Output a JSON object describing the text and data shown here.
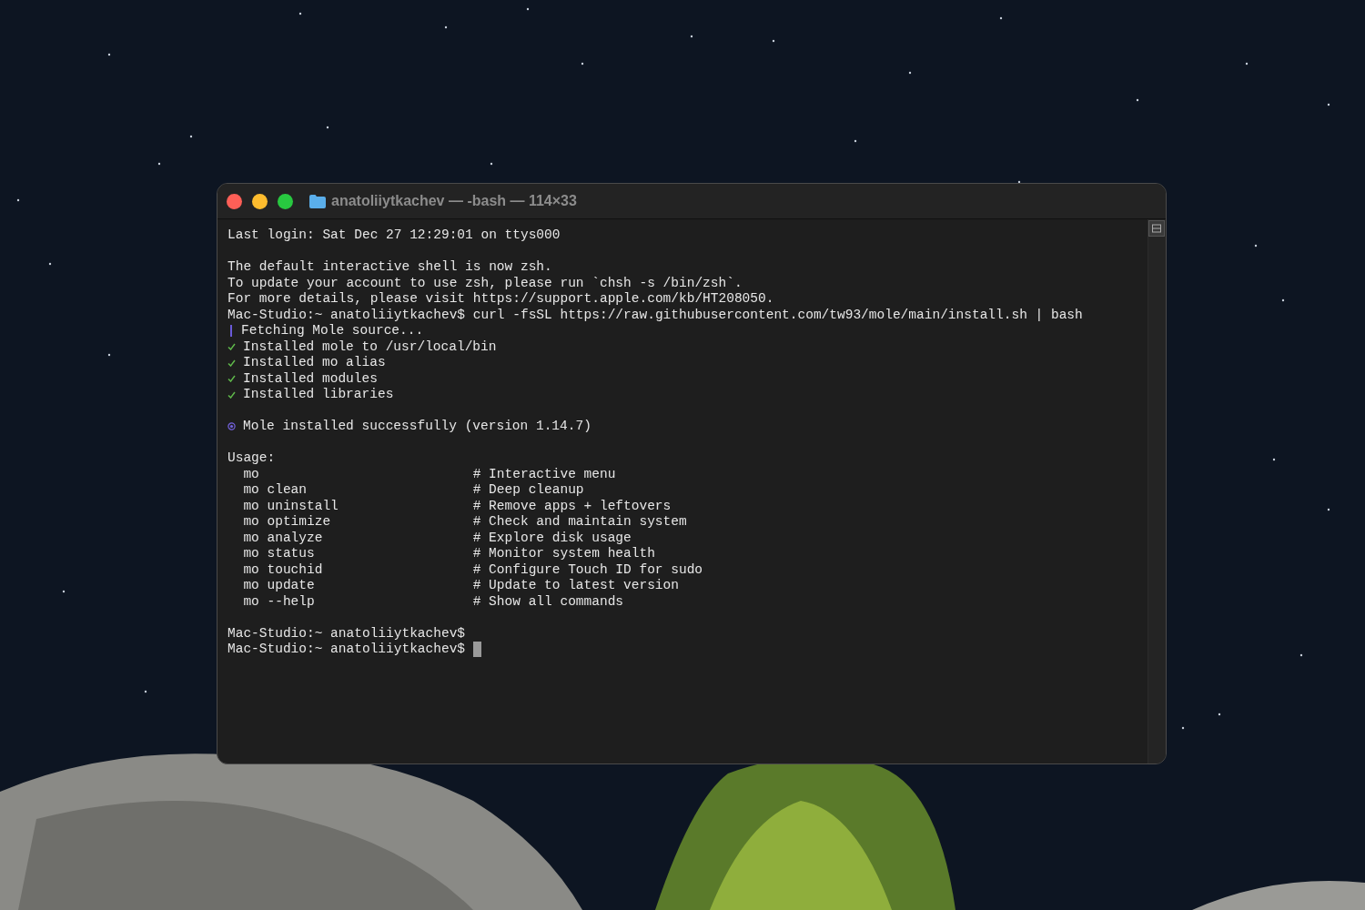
{
  "window": {
    "title": "anatoliiytkachev — -bash — 114×33"
  },
  "lines": [
    {
      "kind": "text",
      "text": "Last login: Sat Dec 27 12:29:01 on ttys000"
    },
    {
      "kind": "blank"
    },
    {
      "kind": "text",
      "text": "The default interactive shell is now zsh."
    },
    {
      "kind": "text",
      "text": "To update your account to use zsh, please run `chsh -s /bin/zsh`."
    },
    {
      "kind": "text",
      "text": "For more details, please visit https://support.apple.com/kb/HT208050."
    },
    {
      "kind": "text",
      "text": "Mac-Studio:~ anatoliiytkachev$ curl -fsSL https://raw.githubusercontent.com/tw93/mole/main/install.sh | bash"
    },
    {
      "kind": "progress",
      "text": "Fetching Mole source..."
    },
    {
      "kind": "done",
      "text": "Installed mole to /usr/local/bin"
    },
    {
      "kind": "done",
      "text": "Installed mo alias"
    },
    {
      "kind": "done",
      "text": "Installed modules"
    },
    {
      "kind": "done",
      "text": "Installed libraries"
    },
    {
      "kind": "blank"
    },
    {
      "kind": "success",
      "text": "Mole installed successfully (version 1.14.7)"
    },
    {
      "kind": "blank"
    },
    {
      "kind": "text",
      "text": "Usage:"
    },
    {
      "kind": "usage",
      "command": "mo",
      "comment": "# Interactive menu"
    },
    {
      "kind": "usage",
      "command": "mo clean",
      "comment": "# Deep cleanup"
    },
    {
      "kind": "usage",
      "command": "mo uninstall",
      "comment": "# Remove apps + leftovers"
    },
    {
      "kind": "usage",
      "command": "mo optimize",
      "comment": "# Check and maintain system"
    },
    {
      "kind": "usage",
      "command": "mo analyze",
      "comment": "# Explore disk usage"
    },
    {
      "kind": "usage",
      "command": "mo status",
      "comment": "# Monitor system health"
    },
    {
      "kind": "usage",
      "command": "mo touchid",
      "comment": "# Configure Touch ID for sudo"
    },
    {
      "kind": "usage",
      "command": "mo update",
      "comment": "# Update to latest version"
    },
    {
      "kind": "usage",
      "command": "mo --help",
      "comment": "# Show all commands"
    },
    {
      "kind": "blank"
    },
    {
      "kind": "prompt",
      "text": "Mac-Studio:~ anatoliiytkachev$",
      "cursor": false
    },
    {
      "kind": "prompt",
      "text": "Mac-Studio:~ anatoliiytkachev$",
      "cursor": true
    }
  ]
}
